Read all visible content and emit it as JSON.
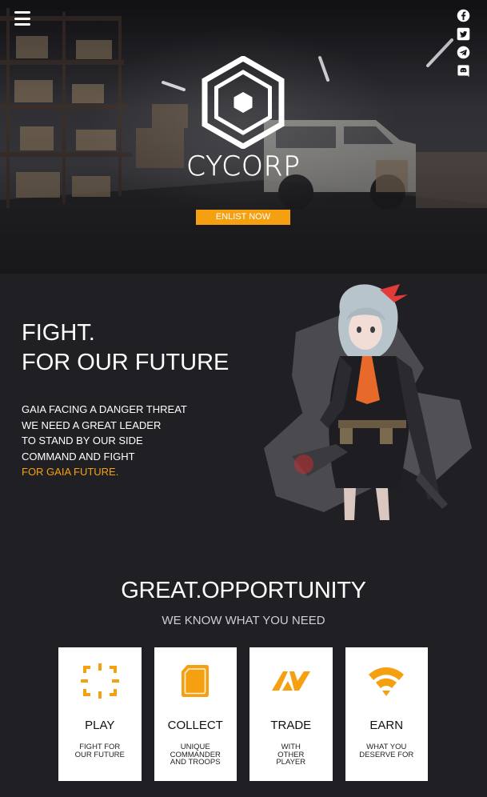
{
  "colors": {
    "accent": "#f5a010",
    "background": "#202024",
    "card_background": "#ffffff"
  },
  "header": {
    "menu_icon": "hamburger-menu-icon",
    "social": [
      {
        "name": "facebook",
        "icon": "facebook-icon"
      },
      {
        "name": "twitter",
        "icon": "twitter-icon"
      },
      {
        "name": "telegram",
        "icon": "telegram-icon"
      },
      {
        "name": "discord",
        "icon": "discord-icon"
      }
    ]
  },
  "hero": {
    "logo_icon": "hexagon-logo-icon",
    "brand": "CYCORP",
    "cta_label": "ENLIST NOW"
  },
  "story": {
    "headline": [
      "FIGHT.",
      "FOR OUR FUTURE"
    ],
    "lines": [
      "GAIA FACING A DANGER THREAT",
      "WE NEED A GREAT LEADER",
      "TO STAND BY OUR SIDE",
      "COMMAND AND FIGHT"
    ],
    "highlight": "FOR GAIA FUTURE."
  },
  "opportunity": {
    "title": "GREAT.OPPORTUNITY",
    "subtitle": "WE KNOW WHAT YOU NEED",
    "cards": [
      {
        "title": "PLAY",
        "desc": [
          "FIGHT FOR",
          "OUR FUTURE"
        ],
        "icon": "crosshair-icon"
      },
      {
        "title": "COLLECT",
        "desc": [
          "UNIQUE",
          "COMMANDER",
          "AND TROOPS"
        ],
        "icon": "card-icon"
      },
      {
        "title": "TRADE",
        "desc": [
          "WITH",
          "OTHER",
          "PLAYER"
        ],
        "icon": "trade-arrows-icon"
      },
      {
        "title": "EARN",
        "desc": [
          "WHAT YOU",
          "DESERVE FOR"
        ],
        "icon": "signal-icon"
      }
    ]
  }
}
